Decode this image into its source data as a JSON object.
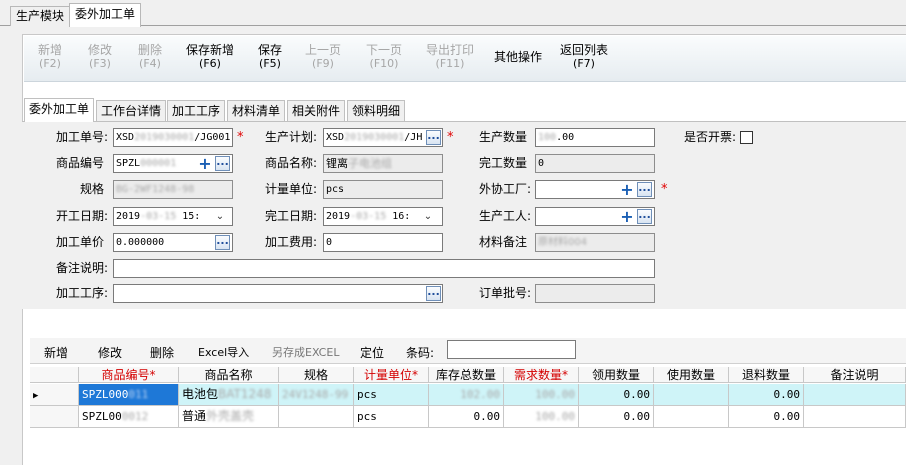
{
  "module_tabs": [
    "生产模块",
    "委外加工单"
  ],
  "toolbar": [
    {
      "label": "新增",
      "key": "(F2)",
      "enabled": false
    },
    {
      "label": "修改",
      "key": "(F3)",
      "enabled": false
    },
    {
      "label": "删除",
      "key": "(F4)",
      "enabled": false
    },
    {
      "label": "保存新增",
      "key": "(F6)",
      "enabled": true
    },
    {
      "label": "保存",
      "key": "(F5)",
      "enabled": true
    },
    {
      "label": "上一页",
      "key": "(F9)",
      "enabled": false
    },
    {
      "label": "下一页",
      "key": "(F10)",
      "enabled": false
    },
    {
      "label": "导出打印",
      "key": "(F11)",
      "enabled": false
    },
    {
      "label": "其他操作",
      "key": "",
      "enabled": true
    },
    {
      "label": "返回列表",
      "key": "(F7)",
      "enabled": true
    }
  ],
  "sub_tabs": [
    "委外加工单",
    "工作台详情",
    "加工工序",
    "材料清单",
    "相关附件",
    "领料明细"
  ],
  "form": {
    "order_no": {
      "label": "加工单号:",
      "value_prefix": "XSD",
      "value_masked": "2019030001",
      "value_suffix": "/JG001"
    },
    "plan": {
      "label": "生产计划:",
      "value_prefix": "XSD",
      "value_masked": "2019030001",
      "value_suffix": "/JH"
    },
    "qty": {
      "label": "生产数量",
      "value_masked": "100",
      "value_suffix": ".00"
    },
    "invoice": {
      "label": "是否开票:"
    },
    "product_code": {
      "label": "商品编号",
      "value_prefix": "SPZL",
      "value_masked": "000001"
    },
    "product_name": {
      "label": "商品名称:",
      "value_prefix": "锂离",
      "value_masked": "子电池组"
    },
    "done_qty": {
      "label": "完工数量",
      "value": "0"
    },
    "spec": {
      "label": "规格",
      "value_masked": "BG-2WF1248-98"
    },
    "unit": {
      "label": "计量单位:",
      "value": "pcs"
    },
    "factory": {
      "label": "外协工厂:",
      "value": ""
    },
    "start_date": {
      "label": "开工日期:",
      "value_prefix": "2019",
      "value_masked": "-03-15",
      "value_suffix": " 15:"
    },
    "end_date": {
      "label": "完工日期:",
      "value_prefix": "2019",
      "value_masked": "-03-15",
      "value_suffix": " 16:"
    },
    "worker": {
      "label": "生产工人:",
      "value": ""
    },
    "unit_price": {
      "label": "加工单价",
      "value": "0.000000"
    },
    "fee": {
      "label": "加工费用:",
      "value": "0"
    },
    "material_note": {
      "label": "材料备注",
      "value_masked": "原材料004"
    },
    "remark": {
      "label": "备注说明:",
      "value": ""
    },
    "process": {
      "label": "加工工序:",
      "value": ""
    },
    "batch": {
      "label": "订单批号:",
      "value": ""
    }
  },
  "grid_toolbar": {
    "add": "新增",
    "edit": "修改",
    "delete": "删除",
    "import": "Excel导入",
    "export": "另存成EXCEL",
    "locate": "定位",
    "barcode_label": "条码:",
    "barcode_value": ""
  },
  "columns": [
    {
      "label": "商品编号*",
      "required": true
    },
    {
      "label": "商品名称",
      "required": false
    },
    {
      "label": "规格",
      "required": false
    },
    {
      "label": "计量单位*",
      "required": true
    },
    {
      "label": "库存总数量",
      "required": false
    },
    {
      "label": "需求数量*",
      "required": true
    },
    {
      "label": "领用数量",
      "required": false
    },
    {
      "label": "使用数量",
      "required": false
    },
    {
      "label": "退料数量",
      "required": false
    },
    {
      "label": "备注说明",
      "required": false
    }
  ],
  "rows": [
    {
      "code": "SPZL000",
      "code_masked": "011",
      "name": "电池包",
      "name_masked": "BAT1248",
      "spec_masked": "24V1248-99",
      "unit": "pcs",
      "stock_masked": "102.00",
      "need_masked": "100.00",
      "recv": "0.00",
      "used": "",
      "returned": "0.00",
      "remark": "",
      "selected": true
    },
    {
      "code": "SPZL00",
      "code_masked": "0012",
      "name": "普通",
      "name_masked": "外壳盖壳",
      "spec_masked": "",
      "unit": "pcs",
      "stock": "0.00",
      "need_masked": "100.00",
      "recv": "0.00",
      "used": "",
      "returned": "0.00",
      "remark": "",
      "selected": false
    }
  ]
}
